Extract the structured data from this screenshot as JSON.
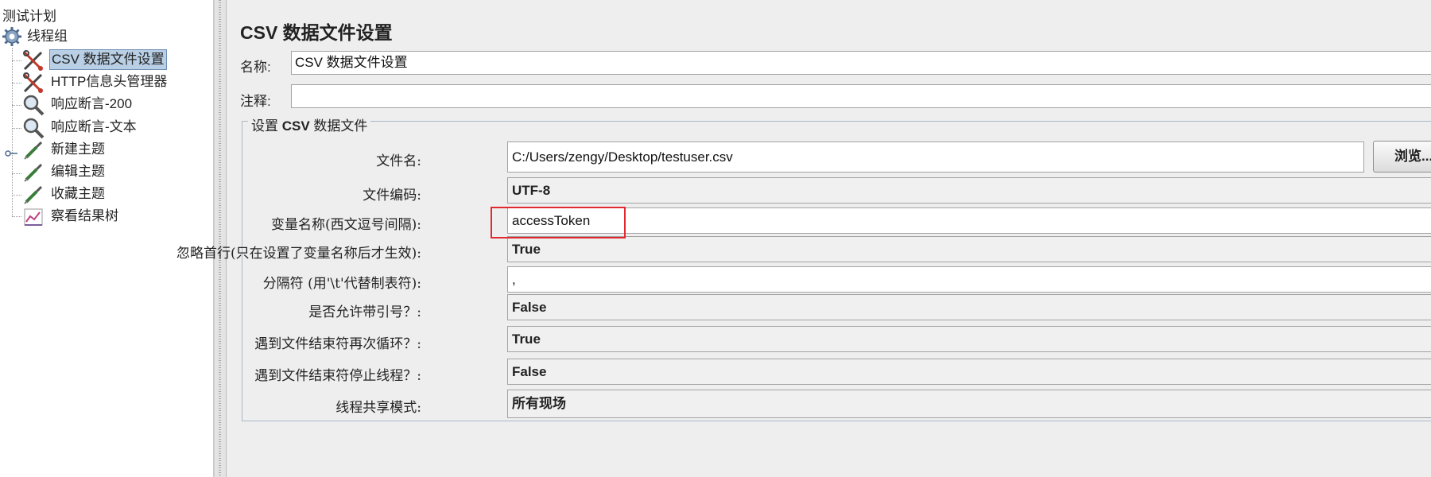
{
  "tree": {
    "root": "测试计划",
    "thread_group": "线程组",
    "items": [
      {
        "label": "CSV 数据文件设置",
        "icon": "scissors-config-icon",
        "selected": true
      },
      {
        "label": "HTTP信息头管理器",
        "icon": "scissors-config-icon",
        "selected": false
      },
      {
        "label": "响应断言-200",
        "icon": "magnifier-assertion-icon",
        "selected": false
      },
      {
        "label": "响应断言-文本",
        "icon": "magnifier-assertion-icon",
        "selected": false
      },
      {
        "label": "新建主题",
        "icon": "pipette-sampler-icon",
        "selected": false
      },
      {
        "label": "编辑主题",
        "icon": "pipette-sampler-icon",
        "selected": false
      },
      {
        "label": "收藏主题",
        "icon": "pipette-sampler-icon",
        "selected": false
      },
      {
        "label": "察看结果树",
        "icon": "chart-listener-icon",
        "selected": false
      }
    ]
  },
  "main": {
    "title": "CSV 数据文件设置",
    "name_label": "名称:",
    "name_value": "CSV 数据文件设置",
    "comment_label": "注释:",
    "comment_value": "",
    "group_legend_prefix": "设置 ",
    "group_legend_bold": "CSV",
    "group_legend_suffix": " 数据文件",
    "browse_label": "浏览...",
    "fields": [
      {
        "label": "文件名:",
        "value": "C:/Users/zengy/Desktop/testuser.csv",
        "kind": "input"
      },
      {
        "label": "文件编码:",
        "value": "UTF-8",
        "kind": "select"
      },
      {
        "label": "变量名称(西文逗号间隔):",
        "value": "accessToken",
        "kind": "input"
      },
      {
        "label": "忽略首行(只在设置了变量名称后才生效):",
        "value": "True",
        "kind": "select"
      },
      {
        "label": "分隔符 (用'\\t'代替制表符):",
        "value": ",",
        "kind": "input"
      },
      {
        "label": "是否允许带引号？:",
        "value": "False",
        "kind": "select"
      },
      {
        "label": "遇到文件结束符再次循环？:",
        "value": "True",
        "kind": "select"
      },
      {
        "label": "遇到文件结束符停止线程？:",
        "value": "False",
        "kind": "select"
      },
      {
        "label": "线程共享模式:",
        "value": "所有现场",
        "kind": "select"
      }
    ]
  },
  "colors": {
    "highlight": "#e3292f",
    "selection": "#b8cfe5"
  }
}
